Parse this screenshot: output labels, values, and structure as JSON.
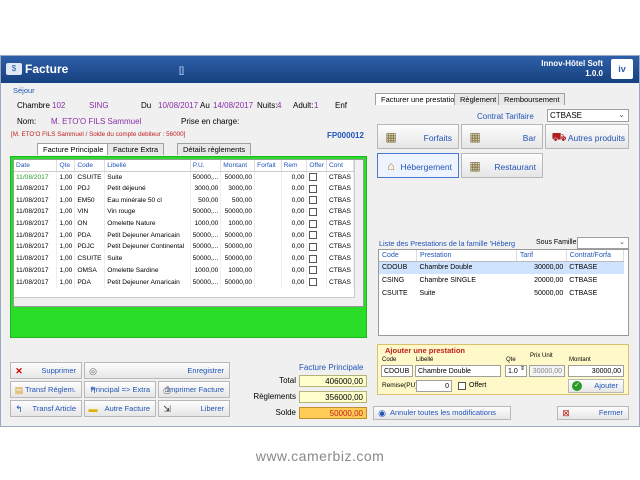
{
  "window": {
    "title": "Facture",
    "bracket": "[]",
    "app_name": "Innov-Hôtel Soft",
    "version": "1.0.0",
    "logo": "iv"
  },
  "sejour": {
    "section": "Séjour",
    "chambre_label": "Chambre",
    "chambre": "102",
    "chambre_type": "SING",
    "du_label": "Du",
    "du": "10/08/2017",
    "au_label": "Au",
    "au": "14/08/2017",
    "nuits_label": "Nuits:",
    "nuits": "4",
    "adult_label": "Adult:",
    "adult": "1",
    "enf_label": "Enf",
    "nom_label": "Nom:",
    "nom": "M. ETO'O FILS Sammuel",
    "prise_label": "Prise en charge:",
    "debit_line": "[M. ETO'O FILS Sammuel / Solde du compte debiteur : 56000]",
    "invoice_no": "FP000012"
  },
  "left_tabs": [
    "Facture Principale",
    "Facture Extra",
    "Détails règlements"
  ],
  "table": {
    "columns": [
      "Date",
      "Qte",
      "Code",
      "Libellé",
      "P.U.",
      "Montant",
      "Forfait",
      "Rem",
      "Offer",
      "Cont"
    ],
    "rows": [
      [
        "11/08/2017",
        "1,00",
        "CSUITE",
        "Suite",
        "50000,...",
        "50000,00",
        "",
        "0,00",
        "",
        "CTBAS"
      ],
      [
        "11/08/2017",
        "1,00",
        "PDJ",
        "Petit déjeuné",
        "3000,00",
        "3000,00",
        "",
        "0,00",
        "",
        "CTBAS"
      ],
      [
        "11/08/2017",
        "1,00",
        "EM50",
        "Eau minérale 50 cl",
        "500,00",
        "500,00",
        "",
        "0,00",
        "",
        "CTBAS"
      ],
      [
        "11/08/2017",
        "1,00",
        "VIN",
        "Vin rouge",
        "50000,...",
        "50000,00",
        "",
        "0,00",
        "",
        "CTBAS"
      ],
      [
        "11/08/2017",
        "1,00",
        "ON",
        "Omelette Nature",
        "1000,00",
        "1000,00",
        "",
        "0,00",
        "",
        "CTBAS"
      ],
      [
        "11/08/2017",
        "1,00",
        "PDA",
        "Petit Dejeuner Amaricain",
        "50000,...",
        "50000,00",
        "",
        "0,00",
        "",
        "CTBAS"
      ],
      [
        "11/08/2017",
        "1,00",
        "PDJC",
        "Petit Dejeuner Continental",
        "50000,...",
        "50000,00",
        "",
        "0,00",
        "",
        "CTBAS"
      ],
      [
        "11/08/2017",
        "1,00",
        "CSUITE",
        "Suite",
        "50000,...",
        "50000,00",
        "",
        "0,00",
        "",
        "CTBAS"
      ],
      [
        "11/08/2017",
        "1,00",
        "OMSA",
        "Omelette Sardine",
        "1000,00",
        "1000,00",
        "",
        "0,00",
        "",
        "CTBAS"
      ],
      [
        "11/08/2017",
        "1,00",
        "PDA",
        "Petit Dejeuner Amaricain",
        "50000,...",
        "50000,00",
        "",
        "0,00",
        "",
        "CTBAS"
      ]
    ]
  },
  "buttons": {
    "supprimer": "Supprimer",
    "enregistrer": "Enregistrer",
    "transf_reglem": "Transf Réglem.",
    "principal_extra": "Principal => Extra",
    "imprimer": "Imprimer Facture",
    "transf_article": "Transf Article",
    "autre_facture": "Autre Facture",
    "liberer": "Liberer",
    "annuler": "Annuler toutes les modifications",
    "fermer": "Fermer",
    "ajouter": "Ajouter"
  },
  "totals": {
    "title": "Facture Principale",
    "total_label": "Total",
    "total": "406000,00",
    "reglements_label": "Règlements",
    "reglements": "356000,00",
    "solde_label": "Solde",
    "solde": "50000,00"
  },
  "right_tabs": [
    "Facturer une prestation",
    "Règlement",
    "Remboursement"
  ],
  "contrat": {
    "label": "Contrat Tarifaire",
    "value": "CTBASE"
  },
  "familles": [
    "Forfaits",
    "Bar",
    "Autres produits",
    "Hébergement",
    "Restaurant"
  ],
  "prestations": {
    "title": "Liste des Prestations de la famille 'Héberg",
    "sous_famille": "Sous Famille",
    "columns": [
      "Code",
      "Prestation",
      "Tarif",
      "Contrat/Forfa"
    ],
    "rows": [
      [
        "CDOUB",
        "Chambre Double",
        "30000,00",
        "CTBASE"
      ],
      [
        "CSING",
        "Chambre SINGLE",
        "20000,00",
        "CTBASE"
      ],
      [
        "CSUITE",
        "Suite",
        "50000,00",
        "CTBASE"
      ]
    ]
  },
  "ajouter": {
    "title": "Ajouter une prestation",
    "code_label": "Code",
    "libelle_label": "Libellé",
    "qte_label": "Qte",
    "pu_label": "Prix Unit",
    "montant_label": "Montant",
    "code": "CDOUB",
    "libelle": "Chambre Double",
    "qte": "1.0",
    "pu": "30000,00",
    "montant": "30000,00",
    "remise_label": "Remise(PU)",
    "remise": "0",
    "offert_label": "Offert"
  },
  "watermark": "www.camerbiz.com",
  "colors": {
    "title_bar": "#2e5fa8",
    "grid_green": "#29dd29",
    "accent_blue": "#2155b8",
    "total_yellow": "#ffffcc",
    "solde_orange": "#ffcc55",
    "selected_row": "#cfe3ff"
  }
}
